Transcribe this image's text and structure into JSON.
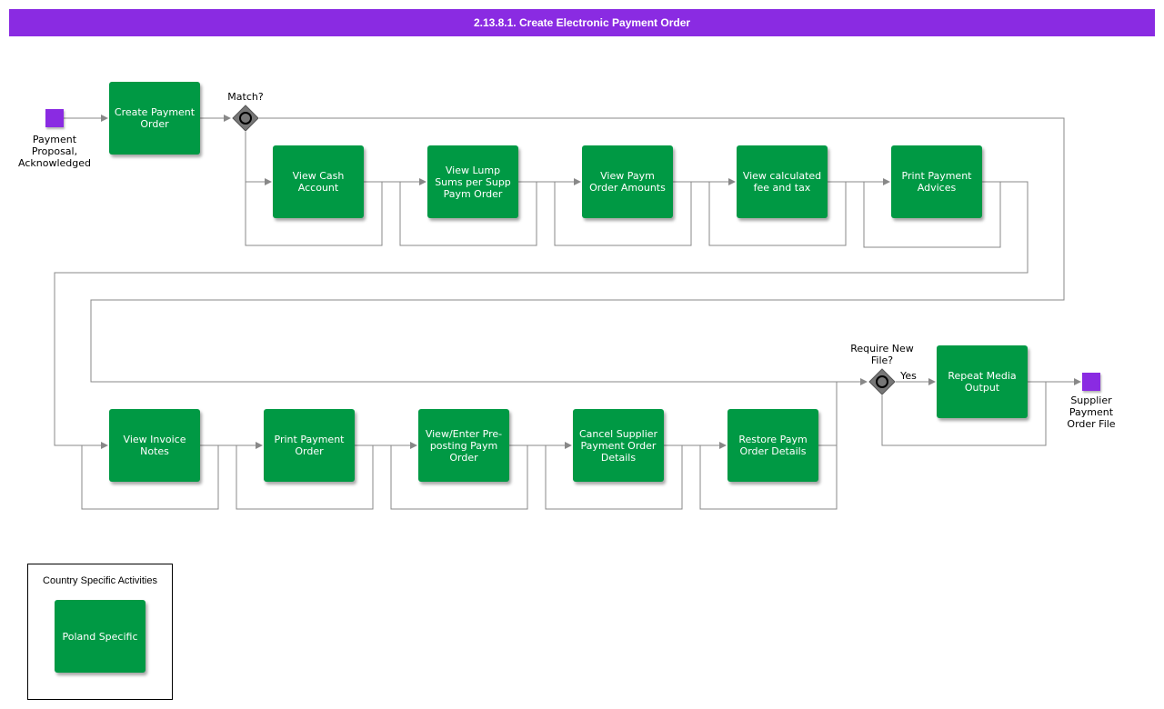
{
  "title": "2.13.8.1. Create Electronic Payment Order",
  "colors": {
    "title_bar": "#8a2be2",
    "activity": "#009944",
    "event": "#8a2be2",
    "gateway": "#777777",
    "connector": "#888888"
  },
  "start_event": {
    "label": "Payment Proposal, Acknowledged"
  },
  "end_event": {
    "label": "Supplier Payment Order File"
  },
  "gateways": {
    "match": {
      "label": "Match?"
    },
    "new_file": {
      "label": "Require New File?",
      "yes_label": "Yes"
    }
  },
  "activities": {
    "create_payment_order": "Create Payment Order",
    "view_cash_account": "View Cash Account",
    "view_lump_sums": "View Lump Sums per Supp Paym Order",
    "view_paym_order_amounts": "View Paym Order Amounts",
    "view_calculated_fee": "View calculated fee and tax",
    "print_payment_advices": "Print Payment Advices",
    "view_invoice_notes": "View Invoice Notes",
    "print_payment_order": "Print Payment Order",
    "view_enter_preposting": "View/Enter Pre-posting Paym Order",
    "cancel_supplier_payment_order": "Cancel Supplier Payment Order Details",
    "restore_paym_order_details": "Restore Paym Order Details",
    "repeat_media_output": "Repeat Media Output"
  },
  "legend": {
    "title": "Country Specific Activities",
    "item": "Poland Specific"
  }
}
